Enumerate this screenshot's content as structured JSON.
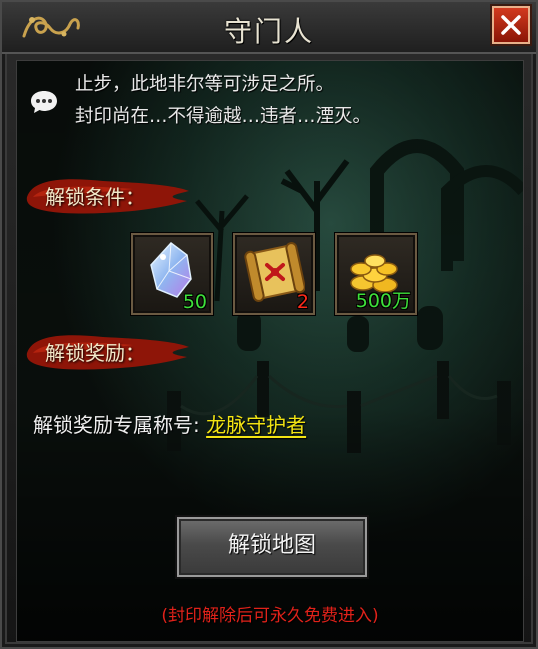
{
  "window": {
    "title": "守门人",
    "close_icon": "close-icon"
  },
  "intro": {
    "line1": "止步，此地非尔等可涉足之所。",
    "line2": "封印尚在…不得逾越…违者…湮灭。"
  },
  "conditions": {
    "label": "解锁条件：",
    "items": [
      {
        "icon": "crystal-icon",
        "count": "50",
        "count_color": "#3ee03a"
      },
      {
        "icon": "scroll-icon",
        "count": "2",
        "count_color": "#ff2a1a"
      },
      {
        "icon": "gold-coins-icon",
        "count": "500万",
        "count_color": "#3ee03a"
      }
    ]
  },
  "rewards": {
    "label": "解锁奖励：",
    "text": "解锁奖励专属称号:",
    "title_name": "龙脉守护者"
  },
  "unlock_button": "解锁地图",
  "footnote": "(封印解除后可永久免费进入)",
  "colors": {
    "accent_yellow": "#f2e413",
    "warning_red": "#e0221a",
    "count_green": "#3ee03a"
  }
}
